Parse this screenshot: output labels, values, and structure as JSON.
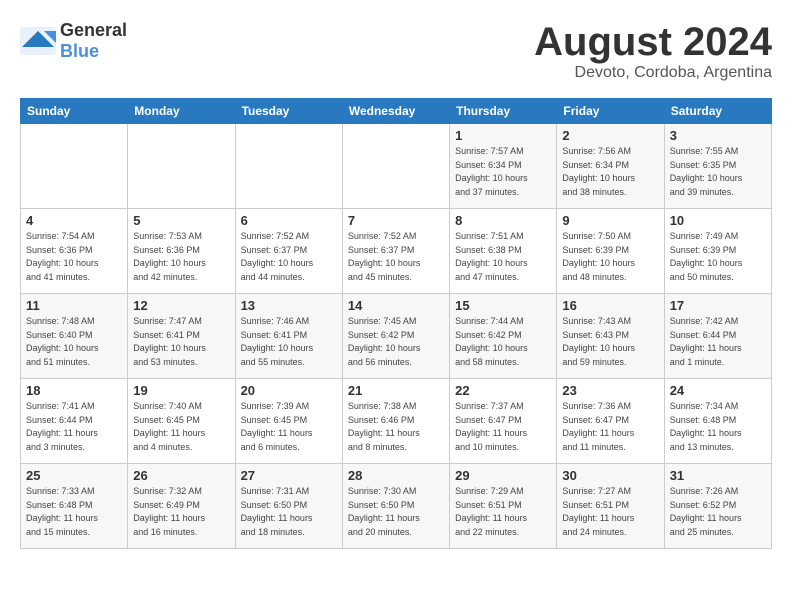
{
  "logo": {
    "general": "General",
    "blue": "Blue"
  },
  "title": "August 2024",
  "subtitle": "Devoto, Cordoba, Argentina",
  "days_of_week": [
    "Sunday",
    "Monday",
    "Tuesday",
    "Wednesday",
    "Thursday",
    "Friday",
    "Saturday"
  ],
  "weeks": [
    [
      {
        "day": "",
        "info": ""
      },
      {
        "day": "",
        "info": ""
      },
      {
        "day": "",
        "info": ""
      },
      {
        "day": "",
        "info": ""
      },
      {
        "day": "1",
        "info": "Sunrise: 7:57 AM\nSunset: 6:34 PM\nDaylight: 10 hours\nand 37 minutes."
      },
      {
        "day": "2",
        "info": "Sunrise: 7:56 AM\nSunset: 6:34 PM\nDaylight: 10 hours\nand 38 minutes."
      },
      {
        "day": "3",
        "info": "Sunrise: 7:55 AM\nSunset: 6:35 PM\nDaylight: 10 hours\nand 39 minutes."
      }
    ],
    [
      {
        "day": "4",
        "info": "Sunrise: 7:54 AM\nSunset: 6:36 PM\nDaylight: 10 hours\nand 41 minutes."
      },
      {
        "day": "5",
        "info": "Sunrise: 7:53 AM\nSunset: 6:36 PM\nDaylight: 10 hours\nand 42 minutes."
      },
      {
        "day": "6",
        "info": "Sunrise: 7:52 AM\nSunset: 6:37 PM\nDaylight: 10 hours\nand 44 minutes."
      },
      {
        "day": "7",
        "info": "Sunrise: 7:52 AM\nSunset: 6:37 PM\nDaylight: 10 hours\nand 45 minutes."
      },
      {
        "day": "8",
        "info": "Sunrise: 7:51 AM\nSunset: 6:38 PM\nDaylight: 10 hours\nand 47 minutes."
      },
      {
        "day": "9",
        "info": "Sunrise: 7:50 AM\nSunset: 6:39 PM\nDaylight: 10 hours\nand 48 minutes."
      },
      {
        "day": "10",
        "info": "Sunrise: 7:49 AM\nSunset: 6:39 PM\nDaylight: 10 hours\nand 50 minutes."
      }
    ],
    [
      {
        "day": "11",
        "info": "Sunrise: 7:48 AM\nSunset: 6:40 PM\nDaylight: 10 hours\nand 51 minutes."
      },
      {
        "day": "12",
        "info": "Sunrise: 7:47 AM\nSunset: 6:41 PM\nDaylight: 10 hours\nand 53 minutes."
      },
      {
        "day": "13",
        "info": "Sunrise: 7:46 AM\nSunset: 6:41 PM\nDaylight: 10 hours\nand 55 minutes."
      },
      {
        "day": "14",
        "info": "Sunrise: 7:45 AM\nSunset: 6:42 PM\nDaylight: 10 hours\nand 56 minutes."
      },
      {
        "day": "15",
        "info": "Sunrise: 7:44 AM\nSunset: 6:42 PM\nDaylight: 10 hours\nand 58 minutes."
      },
      {
        "day": "16",
        "info": "Sunrise: 7:43 AM\nSunset: 6:43 PM\nDaylight: 10 hours\nand 59 minutes."
      },
      {
        "day": "17",
        "info": "Sunrise: 7:42 AM\nSunset: 6:44 PM\nDaylight: 11 hours\nand 1 minute."
      }
    ],
    [
      {
        "day": "18",
        "info": "Sunrise: 7:41 AM\nSunset: 6:44 PM\nDaylight: 11 hours\nand 3 minutes."
      },
      {
        "day": "19",
        "info": "Sunrise: 7:40 AM\nSunset: 6:45 PM\nDaylight: 11 hours\nand 4 minutes."
      },
      {
        "day": "20",
        "info": "Sunrise: 7:39 AM\nSunset: 6:45 PM\nDaylight: 11 hours\nand 6 minutes."
      },
      {
        "day": "21",
        "info": "Sunrise: 7:38 AM\nSunset: 6:46 PM\nDaylight: 11 hours\nand 8 minutes."
      },
      {
        "day": "22",
        "info": "Sunrise: 7:37 AM\nSunset: 6:47 PM\nDaylight: 11 hours\nand 10 minutes."
      },
      {
        "day": "23",
        "info": "Sunrise: 7:36 AM\nSunset: 6:47 PM\nDaylight: 11 hours\nand 11 minutes."
      },
      {
        "day": "24",
        "info": "Sunrise: 7:34 AM\nSunset: 6:48 PM\nDaylight: 11 hours\nand 13 minutes."
      }
    ],
    [
      {
        "day": "25",
        "info": "Sunrise: 7:33 AM\nSunset: 6:48 PM\nDaylight: 11 hours\nand 15 minutes."
      },
      {
        "day": "26",
        "info": "Sunrise: 7:32 AM\nSunset: 6:49 PM\nDaylight: 11 hours\nand 16 minutes."
      },
      {
        "day": "27",
        "info": "Sunrise: 7:31 AM\nSunset: 6:50 PM\nDaylight: 11 hours\nand 18 minutes."
      },
      {
        "day": "28",
        "info": "Sunrise: 7:30 AM\nSunset: 6:50 PM\nDaylight: 11 hours\nand 20 minutes."
      },
      {
        "day": "29",
        "info": "Sunrise: 7:29 AM\nSunset: 6:51 PM\nDaylight: 11 hours\nand 22 minutes."
      },
      {
        "day": "30",
        "info": "Sunrise: 7:27 AM\nSunset: 6:51 PM\nDaylight: 11 hours\nand 24 minutes."
      },
      {
        "day": "31",
        "info": "Sunrise: 7:26 AM\nSunset: 6:52 PM\nDaylight: 11 hours\nand 25 minutes."
      }
    ]
  ]
}
